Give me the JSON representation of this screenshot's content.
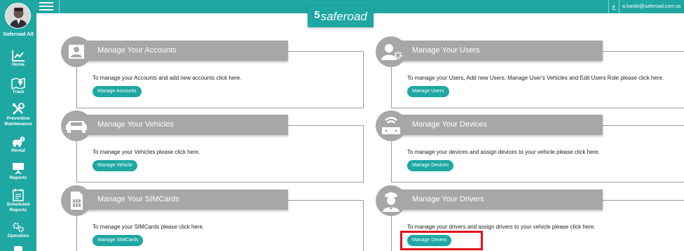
{
  "topbar": {
    "lang_label": "ع",
    "user_email": "a.karaki@saferoad.com.sa"
  },
  "logo": {
    "mark": "5",
    "text": "saferoad"
  },
  "sidebar": {
    "account_name": "Saferoad All",
    "items": [
      {
        "label": "Home",
        "icon": "chart-icon"
      },
      {
        "label": "Track",
        "icon": "map-pin-icon"
      },
      {
        "label": "Preventive Maintenance",
        "icon": "tools-icon"
      },
      {
        "label": "Rental",
        "icon": "car-icon"
      },
      {
        "label": "Reports",
        "icon": "presentation-icon"
      },
      {
        "label": "Scheduled Reports",
        "icon": "calendar-icon"
      },
      {
        "label": "Operation",
        "icon": "gears-icon"
      }
    ]
  },
  "cards": [
    {
      "title": "Manage Your Accounts",
      "description": "To manage your Accounts and add new accounts click here.",
      "button": "Manage Accounts",
      "icon": "id-card-icon"
    },
    {
      "title": "Manage Your Users",
      "description": "To manage your Users, Add new Users, Manage User's Vehicles and Edit Users Role please click here.",
      "button": "Manage Users",
      "icon": "user-gear-icon"
    },
    {
      "title": "Manage Your Vehicles",
      "description": "To manage your Vehicles please click here.",
      "button": "Manage Vehicle",
      "icon": "car-front-icon"
    },
    {
      "title": "Manage Your Devices",
      "description": "To manage your devices and assign devices to your vehicle please click here.",
      "button": "Manage Devices",
      "icon": "router-icon"
    },
    {
      "title": "Manage Your SIMCards",
      "description": "To manage your SIMCards please click here.",
      "button": "Manage SIMCards",
      "icon": "sim-card-icon"
    },
    {
      "title": "Manage Your Drivers",
      "description": "To manage your drivers and assign drivers to your vehicle please click here.",
      "button": "Manage Drivers",
      "icon": "driver-icon"
    }
  ],
  "colors": {
    "accent": "#1ea7a3",
    "card_header": "#a7a7a7",
    "highlight": "#e0121b"
  }
}
